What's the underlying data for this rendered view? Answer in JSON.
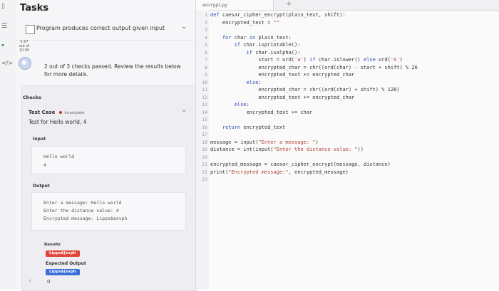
{
  "rail": {
    "icons": [
      "outline-icon",
      "code-icon"
    ],
    "score": [
      "0.67",
      "out of",
      "10.00"
    ]
  },
  "panel": {
    "title": "Tasks",
    "task_label": "Program produces correct output given input",
    "status_text": "2 out of 3 checks passed. Review the results below for more details.",
    "checks_heading": "Checks",
    "test_case_heading": "Test Case",
    "test_case_status": "Incomplete",
    "test_case_name": "Test for Hello world, 4",
    "input_heading": "Input",
    "input_lines": [
      "Hello world",
      "4"
    ],
    "output_heading": "Output",
    "output_lines": [
      "Enter a message: Hello world",
      "Enter the distance value: 4",
      "Encrypted message: Lipps$asvph"
    ],
    "results_heading": "Results",
    "results_value": "Lipps$[svph",
    "expected_heading": "Expected Output",
    "expected_value": "Lipps$[svph",
    "bottom_value": "0"
  },
  "editor": {
    "tab_name": "encrypt.py",
    "lines": [
      "def caesar_cipher_encrypt(plain_text, shift):",
      "    encrypted_text = \"\"",
      "",
      "    for char in plain_text:",
      "        if char.isprintable():",
      "            if char.isalpha():",
      "                start = ord('a') if char.islower() else ord('A')",
      "                encrypted_char = chr((ord(char) - start + shift) % 26",
      "                encrypted_text += encrypted_char",
      "            else:",
      "                encrypted_char = chr((ord(char) + shift) % 128)",
      "                encrypted_text += encrypted_char",
      "        else:",
      "            encrypted_text += char",
      "",
      "    return encrypted_text",
      "",
      "message = input(\"Enter a message: \")",
      "distance = int(input(\"Enter the distance value: \"))",
      "",
      "encrypted_message = caesar_cipher_encrypt(message, distance)",
      "print(\"Encrypted message:\", encrypted_message)",
      ""
    ]
  },
  "colors": {
    "keyword": "#2a4bb5",
    "string": "#b0402e",
    "fail_badge": "#e0463b",
    "pass_badge": "#3b6fd8",
    "status_icon": "#c9d7ec"
  }
}
